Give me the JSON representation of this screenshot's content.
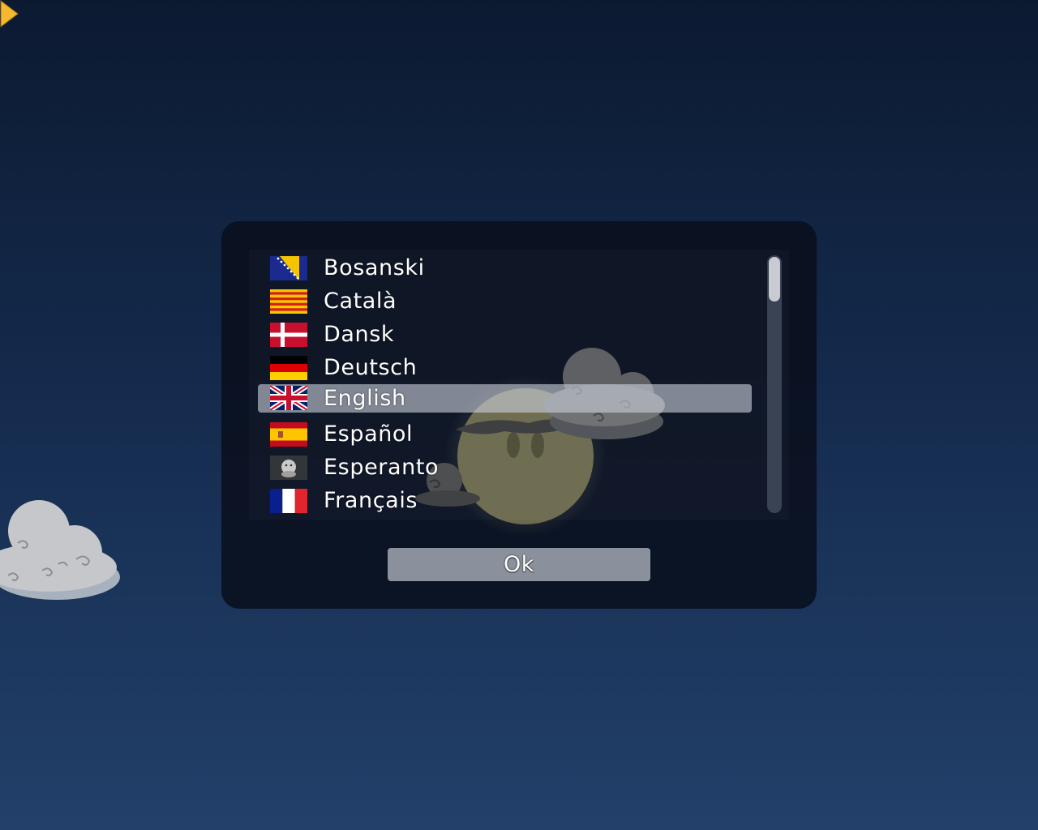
{
  "languages": [
    {
      "label": "Bosanski",
      "flag_icon": "bosnia-flag-icon",
      "selected": false
    },
    {
      "label": "Català",
      "flag_icon": "catalonia-flag-icon",
      "selected": false
    },
    {
      "label": "Dansk",
      "flag_icon": "denmark-flag-icon",
      "selected": false
    },
    {
      "label": "Deutsch",
      "flag_icon": "germany-flag-icon",
      "selected": false
    },
    {
      "label": "English",
      "flag_icon": "uk-flag-icon",
      "selected": true
    },
    {
      "label": "Español",
      "flag_icon": "spain-flag-icon",
      "selected": false
    },
    {
      "label": "Esperanto",
      "flag_icon": "esperanto-flag-icon",
      "selected": false
    },
    {
      "label": "Français",
      "flag_icon": "france-flag-icon",
      "selected": false
    }
  ],
  "ok_button": {
    "label": "Ok"
  },
  "colors": {
    "selection": "#c8cdd7",
    "button": "#8a919c",
    "cursor": "#f5b82e"
  }
}
